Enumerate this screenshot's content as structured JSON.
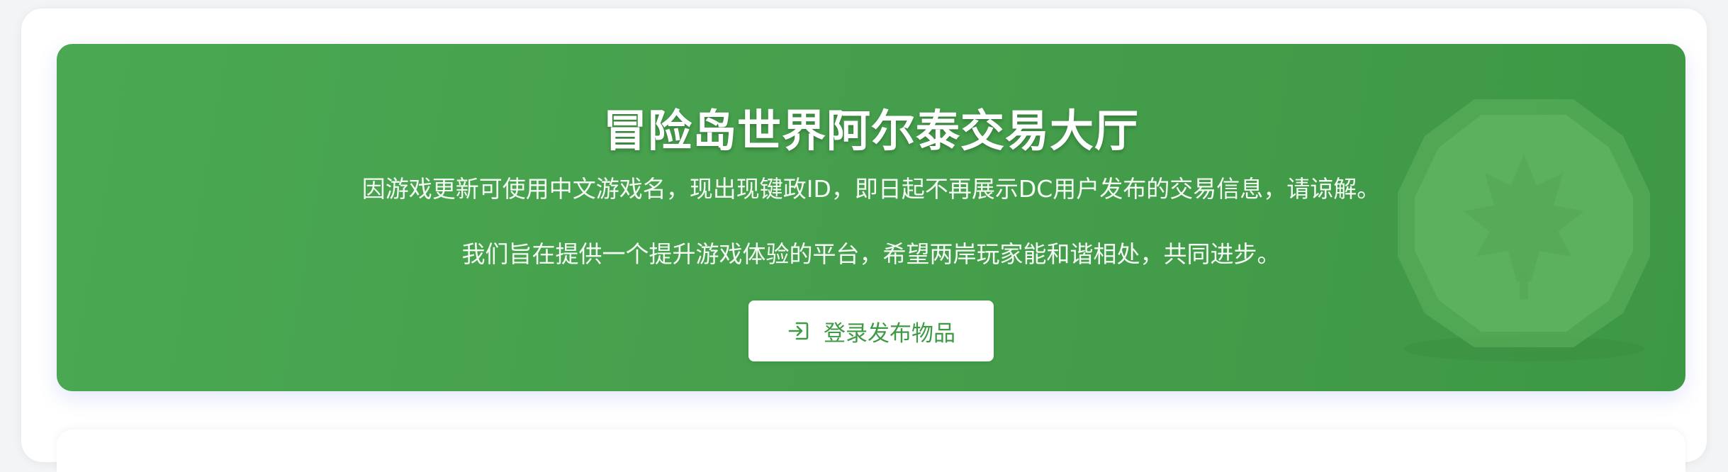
{
  "hero": {
    "title": "冒险岛世界阿尔泰交易大厅",
    "notice": "因游戏更新可使用中文游戏名，现出现键政ID，即日起不再展示DC用户发布的交易信息，请谅解。",
    "mission": "我们旨在提供一个提升游戏体验的平台，希望两岸玩家能和谐相处，共同进步。",
    "login_button": {
      "label": "登录发布物品",
      "icon": "login-icon"
    },
    "emblem_icon": "maple-leaf-coin-icon"
  },
  "colors": {
    "hero_background": "#469f4c",
    "button_text": "#3f9a46",
    "button_background": "#ffffff",
    "title_text": "#ffffff"
  }
}
